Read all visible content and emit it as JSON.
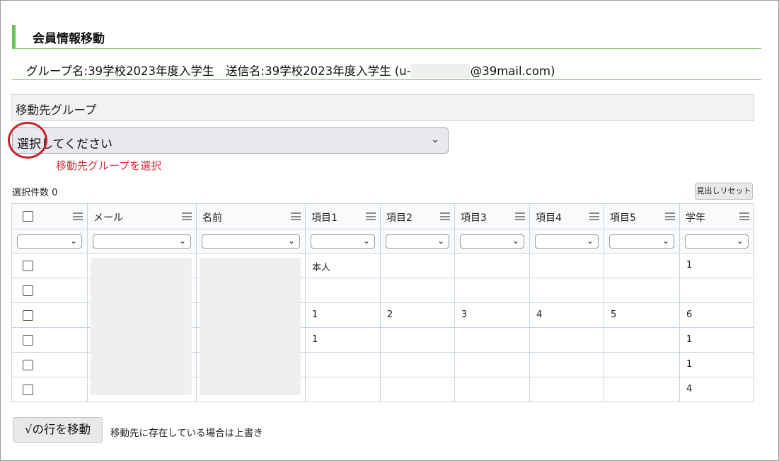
{
  "title": "会員情報移動",
  "group_info": {
    "prefix": "グループ名:39学校2023年度入学生　送信名:39学校2023年度入学生 (u-",
    "suffix": "@39mail.com)"
  },
  "destination": {
    "header": "移動先グループ",
    "select_value": "選択してください",
    "hint": "移動先グループを選択"
  },
  "selection_count": "選択件数 0",
  "reset_button": "見出しリセット",
  "table": {
    "columns": [
      "メール",
      "名前",
      "項目1",
      "項目2",
      "項目3",
      "項目4",
      "項目5",
      "学年"
    ],
    "rows": [
      {
        "c1": "本人",
        "c2": "",
        "c3": "",
        "c4": "",
        "c5": "",
        "grade": "1"
      },
      {
        "c1": "",
        "c2": "",
        "c3": "",
        "c4": "",
        "c5": "",
        "grade": ""
      },
      {
        "c1": "1",
        "c2": "2",
        "c3": "3",
        "c4": "4",
        "c5": "5",
        "grade": "6"
      },
      {
        "c1": "1",
        "c2": "",
        "c3": "",
        "c4": "",
        "c5": "",
        "grade": "1"
      },
      {
        "c1": "",
        "c2": "",
        "c3": "",
        "c4": "",
        "c5": "",
        "grade": "1"
      },
      {
        "c1": "",
        "c2": "",
        "c3": "",
        "c4": "",
        "c5": "",
        "grade": "4"
      }
    ]
  },
  "move_button": "√の行を移動",
  "overwrite_note": "移動先に存在している場合は上書き",
  "colors": {
    "accent_green": "#6cc35a",
    "hint_red": "#d0313a",
    "circle_red": "#c0272d",
    "grid_border": "#c9d5e2"
  }
}
